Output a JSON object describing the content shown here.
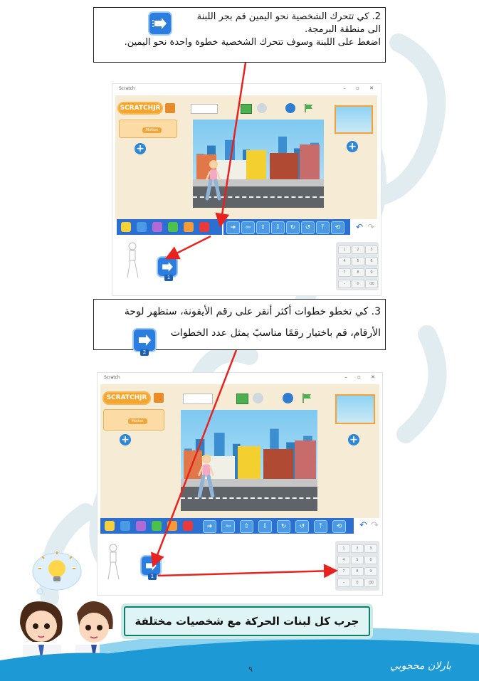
{
  "step2": {
    "line1": "2. كي تتحرك الشخصية نحو اليمين قم بجر اللبنة",
    "line2": "الى منطقة البرمجة.",
    "line3": "اضغط على اللبنة وسوف تتحرك الشخصية خطوة واحدة نحو اليمين."
  },
  "step3": {
    "line1": "3. كي تخطو خطوات أكثر أنقر على رقم الأيقونة، ستظهر لوحة",
    "line2": "الأرقام، قم باختيار رقمًا مناسبً يمثل عدد الخطوات",
    "block_number": "2"
  },
  "screenshot": {
    "window_title": "Scratch",
    "logo_text": "SCRATCHJR",
    "sprite_label": "Motion",
    "script_block_number": "1",
    "keypad_keys": [
      "1",
      "2",
      "3",
      "4",
      "5",
      "6",
      "7",
      "8",
      "9",
      "–",
      "0",
      "⌫"
    ]
  },
  "try_it": "جرب كل لبنات الحركة مع شخصيات مختلفة",
  "page_number": "٩",
  "author": "بارلان محجوبي",
  "colors": {
    "arrow": "#e8231f",
    "palette_bar": "#2a6fd1",
    "motion_block": "#2b7de0",
    "banner_border": "#0e7f6a",
    "footer_wave": "#1d9ad6"
  }
}
